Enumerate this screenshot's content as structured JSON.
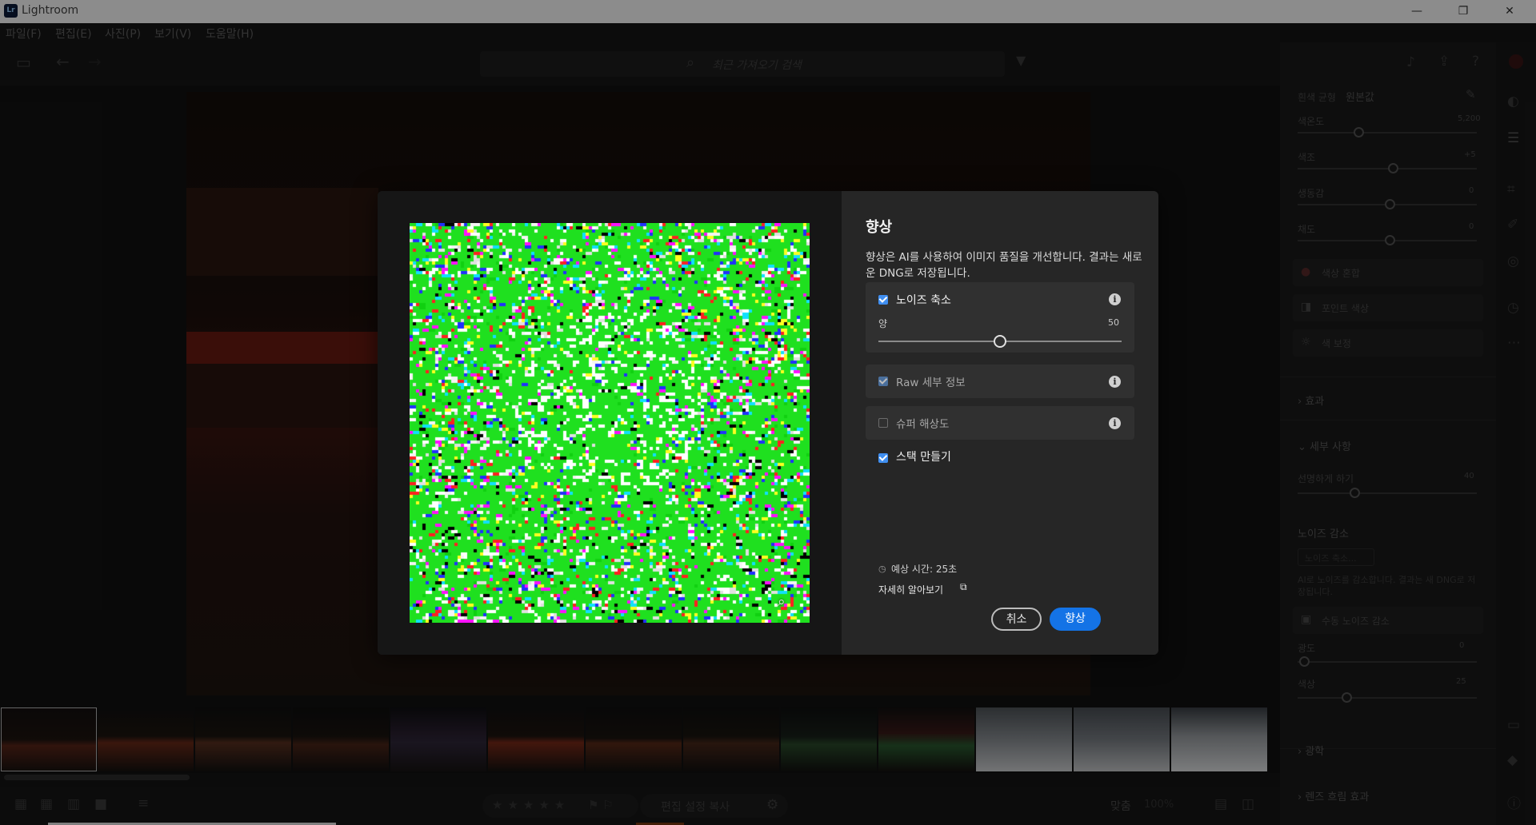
{
  "window": {
    "logo_text": "Lr",
    "title": "Lightroom",
    "minimize": "—",
    "restore": "❐",
    "close": "✕"
  },
  "menu": [
    "파일(F)",
    "편집(E)",
    "사진(P)",
    "보기(V)",
    "도움말(H)"
  ],
  "search": {
    "placeholder": "최근 가져오기 검색"
  },
  "right_panel": {
    "white_balance_label": "흰색 균형",
    "white_balance_value": "원본값",
    "sliders_top": [
      {
        "label": "색온도",
        "value": "5,200"
      },
      {
        "label": "색조",
        "value": "+5"
      },
      {
        "label": "생동감",
        "value": "0"
      },
      {
        "label": "채도",
        "value": "0"
      }
    ],
    "color_sections": [
      "색상 혼합",
      "포인트 색상",
      "색 보정"
    ],
    "effects": "효과",
    "detail": "세부 사항",
    "sharpen_label": "선명하게 하기",
    "sharpen_value": "40",
    "noise_reduction": "노이즈 감소",
    "denoise_button": "노이즈 축소...",
    "noise_desc": "AI로 노이즈를 감소합니다. 결과는 새 DNG로 저장됩니다.",
    "manual_noise": "수동 노이즈 감소",
    "luminance_label": "광도",
    "luminance_value": "0",
    "color_label": "색상",
    "color_value": "25",
    "optics": "광학",
    "lens_blur": "렌즈 흐림 효과"
  },
  "bottom_bar": {
    "copy_settings": "편집 설정 복사",
    "fit": "맞춤",
    "zoom": "100%",
    "stars": "★★★★★"
  },
  "dialog": {
    "title": "향상",
    "description": "향상은 AI를 사용하여 이미지 품질을 개선합니다. 결과는 새로운 DNG로 저장됩니다.",
    "options": {
      "denoise_label": "노이즈 축소",
      "amount_label": "양",
      "amount_value": "50",
      "raw_details_label": "Raw 세부 정보",
      "super_resolution_label": "슈퍼 해상도",
      "create_stack_label": "스택 만들기"
    },
    "estimated_time": "예상 시간: 25초",
    "learn_more": "자세히 알아보기",
    "cancel_button": "취소",
    "enhance_button": "향상"
  },
  "colors": {
    "accent_blue": "#1473e6",
    "checkbox_blue": "#3f8ef0",
    "preview_green": "#1fe01f"
  }
}
